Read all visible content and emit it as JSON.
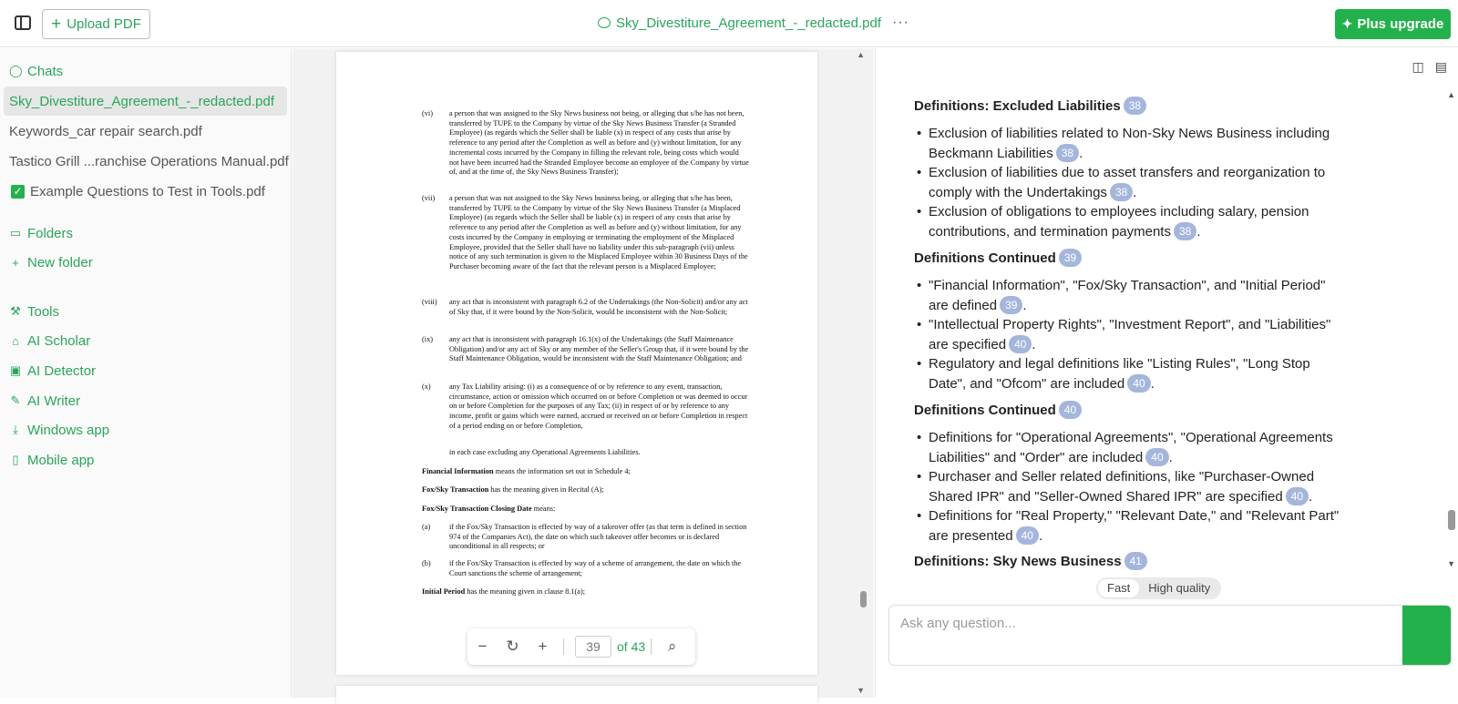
{
  "topbar": {
    "upload_label": "Upload PDF",
    "document_title": "Sky_Divestiture_Agreement_-_redacted.pdf",
    "more_label": "···",
    "upgrade_label": "Plus upgrade"
  },
  "sidebar": {
    "chats_label": "Chats",
    "files": [
      "Sky_Divestiture_Agreement_-_redacted.pdf",
      "Keywords_car repair search.pdf",
      "Tastico Grill ...ranchise Operations Manual.pdf",
      "Example Questions to Test in Tools.pdf"
    ],
    "folders_label": "Folders",
    "new_folder_label": "New folder",
    "tools_label": "Tools",
    "tools": [
      "AI Scholar",
      "AI Detector",
      "AI Writer",
      "Windows app",
      "Mobile app"
    ]
  },
  "viewer": {
    "page_number": "39",
    "page_total": "of 43",
    "items": [
      {
        "num": "(vi)",
        "text": "a person that was assigned to the Sky News business not being, or alleging that s/he has not been, transferred by TUPE to the Company by virtue of the Sky News Business Transfer (a Stranded Employee) (as regards which the Seller shall be liable (x) in respect of any costs that arise by reference to any period after the Completion as well as before and (y) without limitation, for any incremental costs incurred by the Company in filling the relevant role, being costs which would not have been incurred had the Stranded Employee become an employee of the Company by virtue of, and at the time of, the Sky News Business Transfer);"
      },
      {
        "num": "(vii)",
        "text": "a person that was not assigned to the Sky News business being, or alleging that s/he has been, transferred by TUPE to the Company by virtue of the Sky News Business Transfer (a Misplaced Employee) (as regards which the Seller shall be liable (x) in respect of any costs that arise by reference to any period after the Completion as well as before and (y) without limitation, for any costs incurred by the Company in employing or terminating the employment of the Misplaced Employee, provided that the Seller shall have no liability under this sub-paragraph (vii) unless notice of any such termination is given to the Misplaced Employee within 30 Business Days of the Purchaser becoming aware of the fact that the relevant person is a Misplaced Employee;"
      },
      {
        "num": "(viii)",
        "text": "any act that is inconsistent with paragraph 6.2 of the Undertakings (the Non-Solicit) and/or any act of Sky that, if it were bound by the Non-Solicit, would be inconsistent with the Non-Solicit;"
      },
      {
        "num": "(ix)",
        "text": "any act that is inconsistent with paragraph 16.1(x) of the Undertakings (the Staff Maintenance Obligation) and/or any act of Sky or any member of the Seller's Group that, if it were bound by the Staff Maintenance Obligation, would be inconsistent with the Staff Maintenance Obligation; and"
      },
      {
        "num": "(x)",
        "text": "any Tax Liability arising: (i) as a consequence of or by reference to any event, transaction, circumstance, action or omission which occurred on or before Completion or was deemed to occur on or before Completion for the purposes of any Tax; (ii) in respect of or by reference to any income, profit or gains which were earned, accrued or received on or before Completion in respect of a period ending on or before Completion,"
      }
    ],
    "closing_line": "in each case excluding any Operational Agreements Liabilities.",
    "def1_term": "Financial Information",
    "def1_text": " means the information set out in Schedule 4;",
    "def2_term": "Fox/Sky Transaction",
    "def2_text": " has the meaning given in Recital (A);",
    "def3_term": "Fox/Sky Transaction Closing Date",
    "def3_text": " means:",
    "sub_a_num": "(a)",
    "sub_a_text": "if the Fox/Sky Transaction is effected by way of a takeover offer (as that term is defined in section 974 of the Companies Act), the date on which such takeover offer becomes or is declared unconditional in all respects; or",
    "sub_b_num": "(b)",
    "sub_b_text": "if the Fox/Sky Transaction is effected by way of a scheme of arrangement, the date on which the Court sanctions the scheme of arrangement;",
    "def4_term": "Initial Period",
    "def4_text": " has the meaning given in clause 8.1(a);"
  },
  "chat": {
    "sections": [
      {
        "heading": "Definitions: Excluded Liabilities",
        "badge": "38",
        "bullets": [
          {
            "text": "Exclusion of liabilities related to Non-Sky News Business including Beckmann Liabilities",
            "badge": "38"
          },
          {
            "text": "Exclusion of liabilities due to asset transfers and reorganization to comply with the Undertakings",
            "badge": "38"
          },
          {
            "text": "Exclusion of obligations to employees including salary, pension contributions, and termination payments",
            "badge": "38"
          }
        ]
      },
      {
        "heading": "Definitions Continued",
        "badge": "39",
        "bullets": [
          {
            "text": "\"Financial Information\", \"Fox/Sky Transaction\", and \"Initial Period\" are defined",
            "badge": "39"
          },
          {
            "text": "\"Intellectual Property Rights\", \"Investment Report\", and \"Liabilities\" are specified",
            "badge": "40"
          },
          {
            "text": "Regulatory and legal definitions like \"Listing Rules\", \"Long Stop Date\", and \"Ofcom\" are included",
            "badge": "40"
          }
        ]
      },
      {
        "heading": "Definitions Continued",
        "badge": "40",
        "bullets": [
          {
            "text": "Definitions for \"Operational Agreements\", \"Operational Agreements Liabilities\" and \"Order\" are included",
            "badge": "40"
          },
          {
            "text": "Purchaser and Seller related definitions, like \"Purchaser-Owned Shared IPR\" and \"Seller-Owned Shared IPR\" are specified",
            "badge": "40"
          },
          {
            "text": "Definitions for \"Real Property,\" \"Relevant Date,\" and \"Relevant Part\" are presented",
            "badge": "40"
          }
        ]
      },
      {
        "heading": "Definitions: Sky News Business",
        "badge": "41",
        "bullets": []
      }
    ],
    "quality_fast": "Fast",
    "quality_high": "High quality",
    "ask_placeholder": "Ask any question..."
  },
  "colors": {
    "accent": "#22b14c",
    "badge": "#a4b6dc"
  }
}
